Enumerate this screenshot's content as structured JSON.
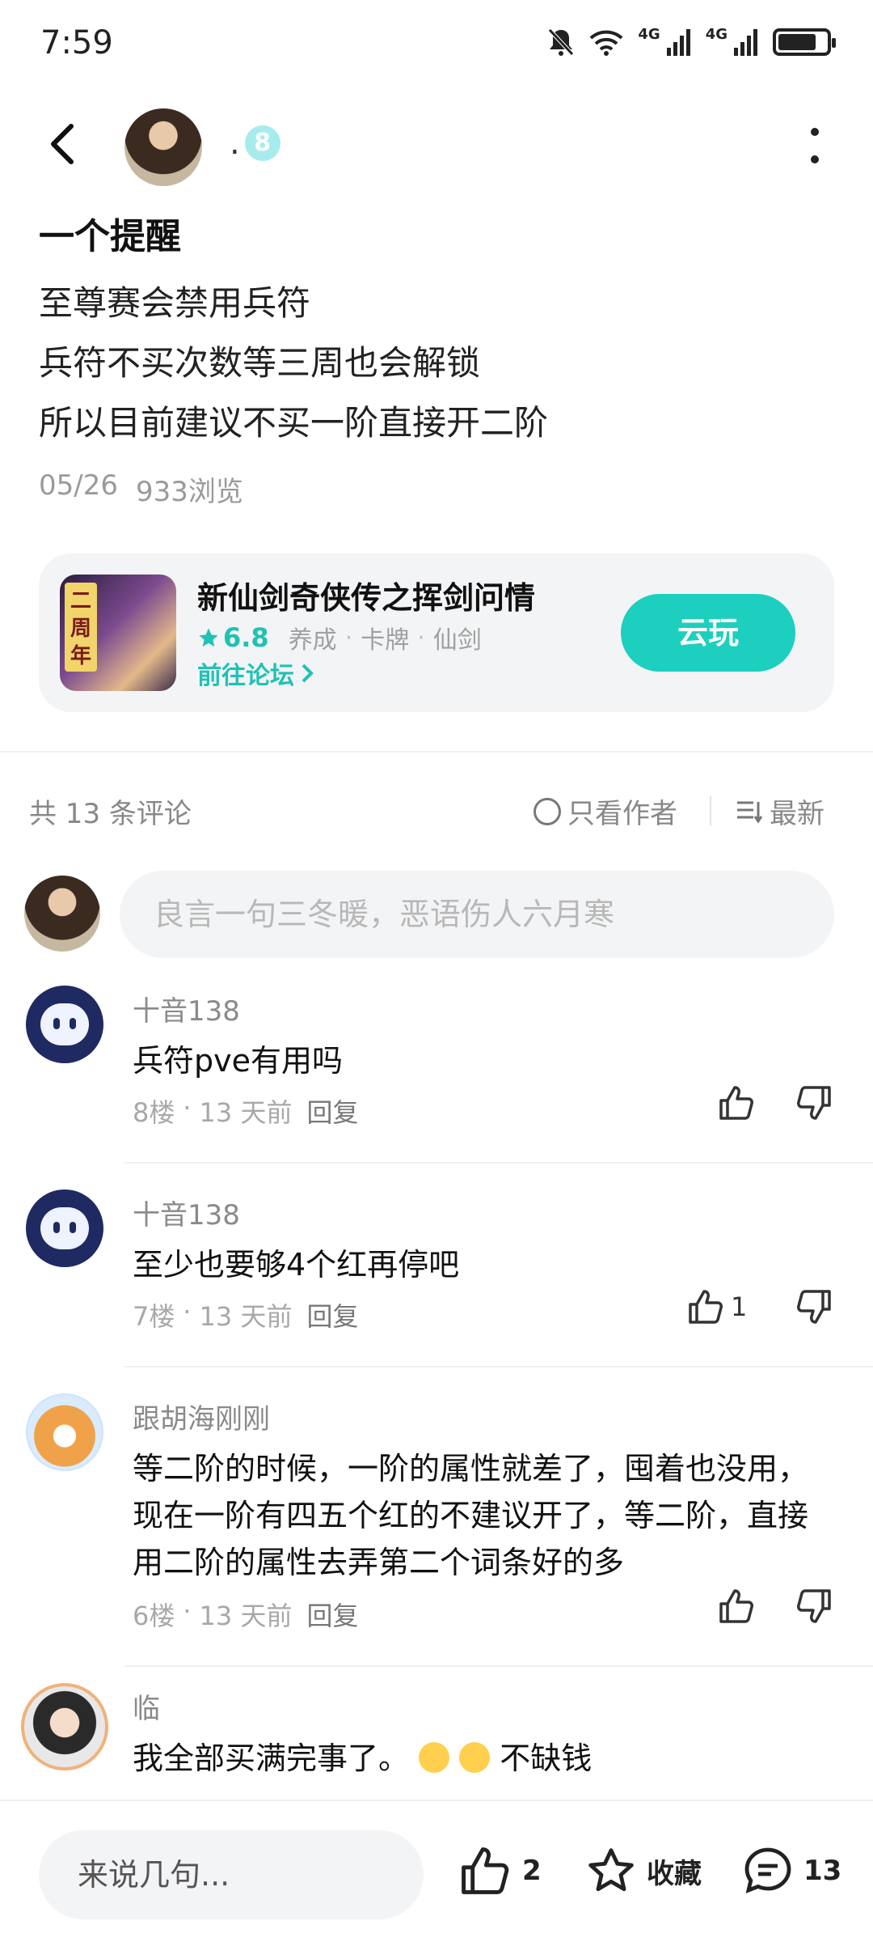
{
  "status_bar": {
    "time": "7:59",
    "net1": "4G",
    "net2": "4G",
    "battery_level": 0.8
  },
  "header": {
    "username": ".",
    "level": "8"
  },
  "post": {
    "title": "一个提醒",
    "lines": [
      "至尊赛会禁用兵符",
      "兵符不买次数等三周也会解锁",
      "所以目前建议不买一阶直接开二阶"
    ],
    "date": "05/26",
    "views": "933浏览"
  },
  "game": {
    "icon_tag": "二周年",
    "name": "新仙剑奇侠传之挥剑问情",
    "rating": "6.8",
    "tags": [
      "养成",
      "卡牌",
      "仙剑"
    ],
    "forum_link": "前往论坛",
    "play_button": "云玩"
  },
  "comments_header": {
    "count_label": "共 13 条评论",
    "only_author": "只看作者",
    "sort": "最新"
  },
  "comment_input": {
    "placeholder": "良言一句三冬暖，恶语伤人六月寒"
  },
  "comments": [
    {
      "name": "十音138",
      "text": "兵符pve有用吗",
      "floor": "8楼",
      "time": "13 天前",
      "reply": "回复",
      "likes": ""
    },
    {
      "name": "十音138",
      "text": "至少也要够4个红再停吧",
      "floor": "7楼",
      "time": "13 天前",
      "reply": "回复",
      "likes": "1"
    },
    {
      "name": "跟胡海刚刚",
      "text": "等二阶的时候，一阶的属性就差了，囤着也没用，现在一阶有四五个红的不建议开了，等二阶，直接用二阶的属性去弄第二个词条好的多",
      "floor": "6楼",
      "time": "13 天前",
      "reply": "回复",
      "likes": ""
    },
    {
      "name": "临",
      "text_before": "我全部买满完事了。",
      "text_after": "不缺钱"
    }
  ],
  "bottom_bar": {
    "input_label": "来说几句...",
    "likes": "2",
    "favorite": "收藏",
    "comments": "13"
  },
  "colors": {
    "accent": "#1ccfbf",
    "rating": "#1fc2b4"
  }
}
